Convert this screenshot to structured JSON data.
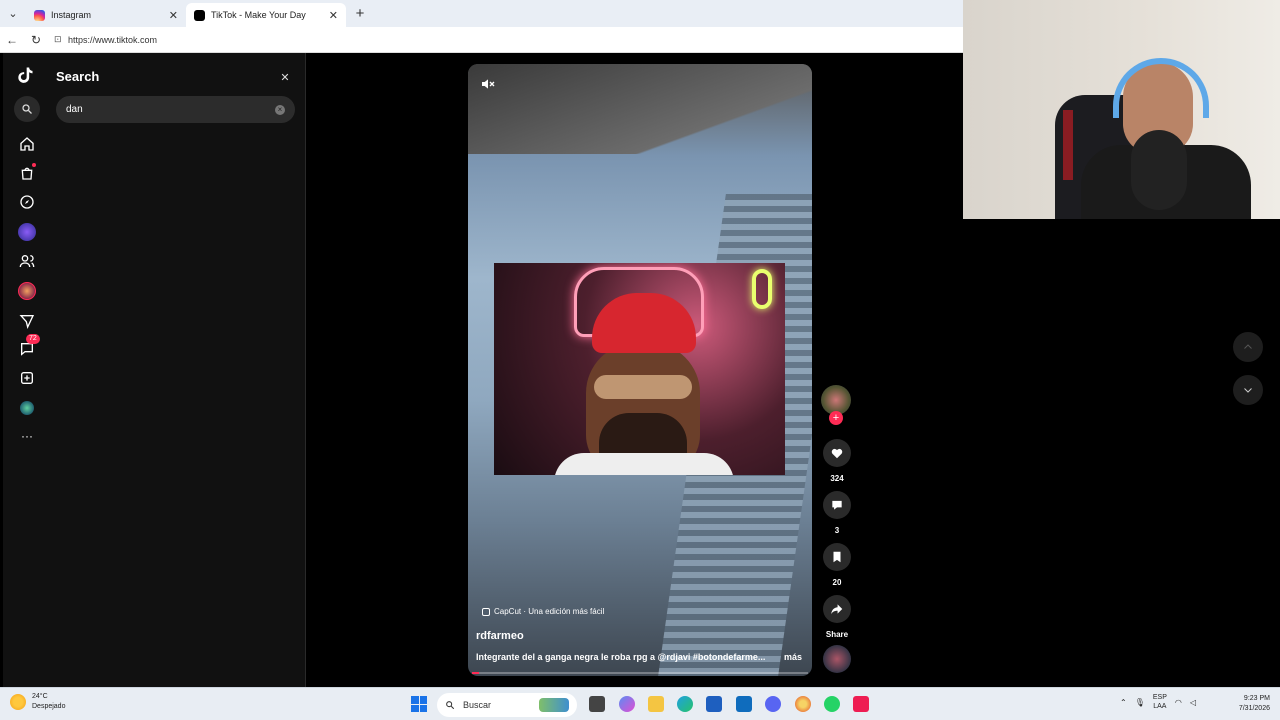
{
  "browser": {
    "tabs": [
      {
        "title": "Instagram",
        "favicon_color": "#e1306c",
        "active": false
      },
      {
        "title": "TikTok - Make Your Day",
        "favicon_color": "#000000",
        "active": true
      }
    ],
    "new_tab_symbol": "+",
    "close_symbol": "✕",
    "url": "https://www.tiktok.com"
  },
  "tiktok": {
    "search_panel": {
      "title": "Search",
      "query": "dan",
      "close_symbol": "✕"
    },
    "nav": [
      {
        "icon": "home-icon"
      },
      {
        "icon": "shop-icon",
        "has_dot": true
      },
      {
        "icon": "explore-icon"
      },
      {
        "icon": "live-avatar-icon"
      },
      {
        "icon": "following-icon"
      },
      {
        "icon": "friends-avatar-icon"
      },
      {
        "icon": "messages-icon"
      },
      {
        "icon": "activity-icon",
        "badge": "72"
      },
      {
        "icon": "upload-icon"
      },
      {
        "icon": "profile-avatar-icon"
      },
      {
        "icon": "more-icon",
        "label": "···"
      }
    ],
    "video": {
      "capcut_text": "CapCut · Una edición más fácil",
      "author": "rdfarmeo",
      "caption": "Integrante del a ganga negra le roba rpg a @rdjavi #botondefarme...",
      "more_label": "más",
      "progress": 0.0
    },
    "actions": {
      "likes": "324",
      "comments": "3",
      "saves": "20",
      "share_label": "Share",
      "follow_symbol": "+"
    },
    "accent_color": "#fe2c55"
  },
  "taskbar": {
    "weather_temp": "24°C",
    "weather_desc": "Despejado",
    "search_placeholder": "Buscar",
    "lang_line1": "ESP",
    "lang_line2": "LAA",
    "time": "9:23 PM",
    "date": "7/31/2026"
  }
}
